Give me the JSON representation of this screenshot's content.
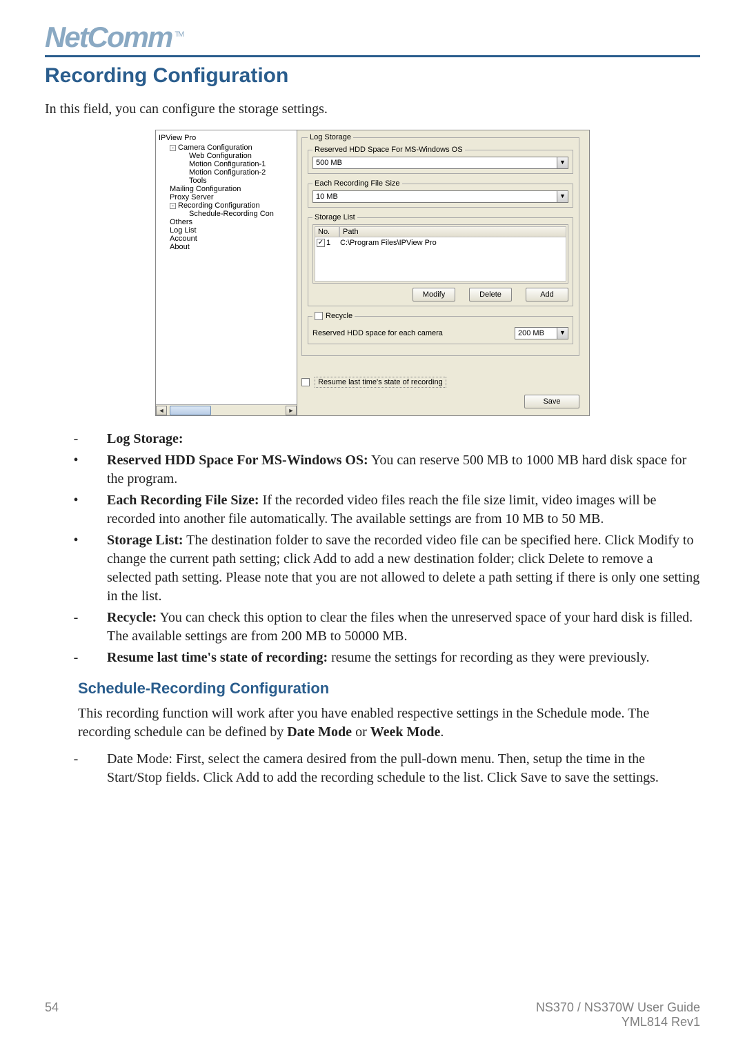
{
  "logo": "NetComm",
  "tm": "TM",
  "title": "Recording Configuration",
  "intro": "In this field, you can configure the storage settings.",
  "tree": {
    "root": "IPView Pro",
    "items": [
      {
        "label": "Camera Configuration",
        "level": 1,
        "expand": "-"
      },
      {
        "label": "Web Configuration",
        "level": 2
      },
      {
        "label": "Motion Configuration-1",
        "level": 2
      },
      {
        "label": "Motion Configuration-2",
        "level": 2
      },
      {
        "label": "Tools",
        "level": 2
      },
      {
        "label": "Mailing Configuration",
        "level": 1
      },
      {
        "label": "Proxy Server",
        "level": 1
      },
      {
        "label": "Recording Configuration",
        "level": 1,
        "expand": "-"
      },
      {
        "label": "Schedule-Recording Con",
        "level": 2
      },
      {
        "label": "Others",
        "level": 1
      },
      {
        "label": "Log List",
        "level": 1
      },
      {
        "label": "Account",
        "level": 1
      },
      {
        "label": "About",
        "level": 1
      }
    ]
  },
  "form": {
    "log_storage_legend": "Log Storage",
    "reserved_legend": "Reserved HDD Space For MS-Windows OS",
    "reserved_value": "500 MB",
    "filesize_legend": "Each Recording File Size",
    "filesize_value": "10 MB",
    "storage_legend": "Storage List",
    "col_no": "No.",
    "col_path": "Path",
    "row_no": "1",
    "row_path": "C:\\Program Files\\IPView Pro",
    "btn_modify": "Modify",
    "btn_delete": "Delete",
    "btn_add": "Add",
    "recycle_legend": "Recycle",
    "recycle_label": "Reserved HDD space for each camera",
    "recycle_value": "200 MB",
    "resume_label": "Resume last time's state of recording",
    "btn_save": "Save"
  },
  "list": {
    "log_storage": "Log Storage:",
    "reserved_b": "Reserved HDD Space For MS-Windows OS:",
    "reserved_t": " You can reserve 500 MB to 1000 MB hard disk space for the program.",
    "filesize_b": "Each Recording File Size:",
    "filesize_t": " If the recorded video files reach the file size limit, video images will be recorded into another file automatically.  The available settings are from 10 MB to 50 MB.",
    "storage_b": "Storage List:",
    "storage_t": " The destination folder to save the recorded video file can be specified here.  Click Modify to change the current path setting; click Add to add a new destination folder; click Delete to remove a selected path setting.  Please note that you are not allowed to delete a path setting if there is only one setting in the list.",
    "recycle_b": "Recycle:",
    "recycle_t": " You can check this option to clear the files when the unreserved space of your hard disk is filled.  The available settings are from 200 MB to 50000 MB.",
    "resume_b": "Resume last time's state of recording:",
    "resume_t": "  resume the settings for recording as they were previously."
  },
  "subhead": "Schedule-Recording Configuration",
  "para": {
    "p1a": "This recording function will work after you have enabled respective settings in the Schedule mode.  The recording schedule can be defined by ",
    "p1b": "Date Mode",
    "p1c": " or ",
    "p1d": "Week Mode",
    "p1e": ".",
    "p2": "Date Mode: First, select the camera desired from the pull-down menu.  Then, setup the time in the Start/Stop fields.  Click Add to add the recording schedule to the list.  Click Save to save the settings."
  },
  "footer": {
    "page": "54",
    "guide": "NS370 / NS370W User Guide",
    "rev": "YML814 Rev1"
  }
}
